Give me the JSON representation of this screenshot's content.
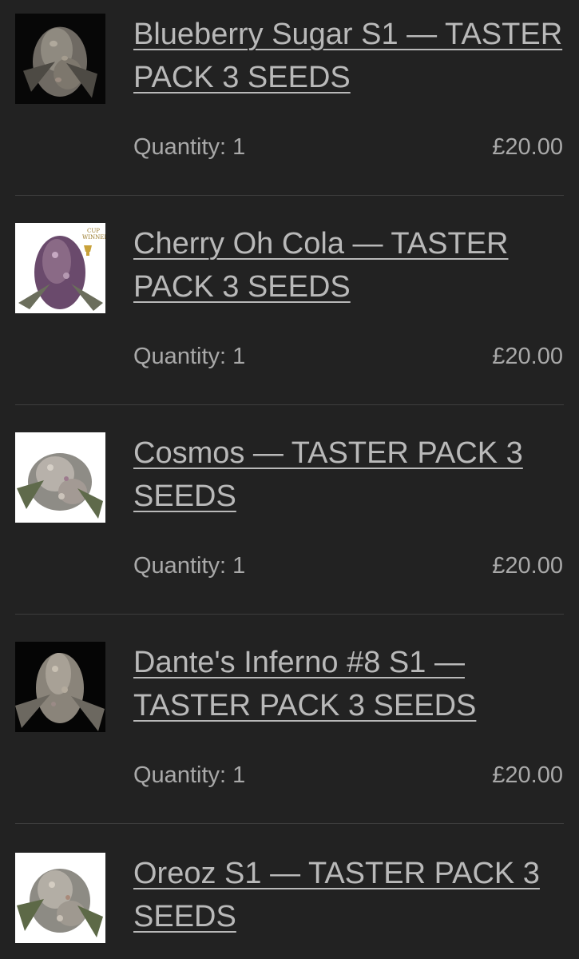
{
  "cart": {
    "items": [
      {
        "title": "Blueberry Sugar S1 — TASTER PACK 3 SEEDS",
        "quantity_text": "Quantity: 1",
        "price": "£20.00",
        "image_icon": "cannabis-bud-dark-image"
      },
      {
        "title": "Cherry Oh Cola — TASTER PACK 3 SEEDS",
        "quantity_text": "Quantity: 1",
        "price": "£20.00",
        "image_icon": "cannabis-bud-purple-image",
        "badge_text": "CUP WINNER"
      },
      {
        "title": "Cosmos — TASTER PACK 3 SEEDS",
        "quantity_text": "Quantity: 1",
        "price": "£20.00",
        "image_icon": "cannabis-bud-light-image"
      },
      {
        "title": "Dante's Inferno #8 S1 — TASTER PACK 3 SEEDS",
        "quantity_text": "Quantity: 1",
        "price": "£20.00",
        "image_icon": "cannabis-bud-dark-image"
      },
      {
        "title": "Oreoz S1 — TASTER PACK 3 SEEDS",
        "image_icon": "cannabis-bud-light-image"
      }
    ]
  },
  "colors": {
    "background": "#222222",
    "text": "#a9a9a9",
    "link": "#b9b9b9",
    "divider": "#3d3d3d"
  }
}
